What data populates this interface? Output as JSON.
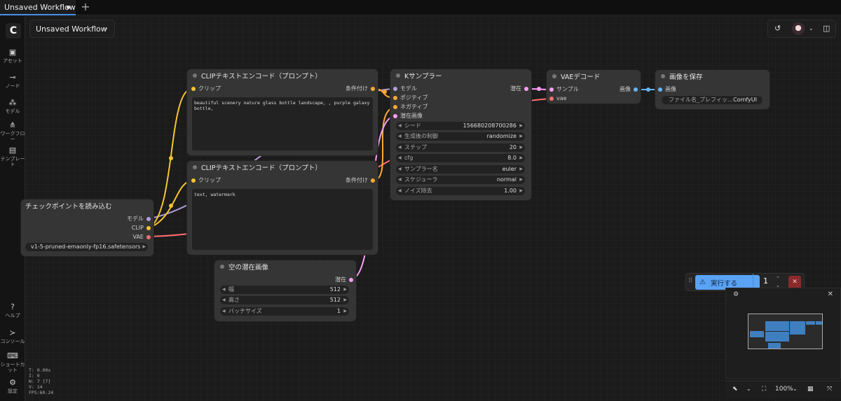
{
  "tab": {
    "title": "Unsaved Workflow",
    "new_tab": "+"
  },
  "workflow_title": "Unsaved Workflow",
  "sidebar": {
    "logo": "C",
    "items": [
      {
        "label": "アセット",
        "icon": "image-icon",
        "glyph": "▣"
      },
      {
        "label": "ノード",
        "icon": "node-icon",
        "glyph": "⊸"
      },
      {
        "label": "モデル",
        "icon": "model-icon",
        "glyph": "⁂"
      },
      {
        "label": "ワークフロー",
        "icon": "workflow-icon",
        "glyph": "⋔"
      },
      {
        "label": "テンプレート",
        "icon": "template-icon",
        "glyph": "▤"
      },
      {
        "label": "ヘルプ",
        "icon": "help-icon",
        "glyph": "?"
      },
      {
        "label": "コンソール",
        "icon": "console-icon",
        "glyph": "≻"
      },
      {
        "label": "ショートカット",
        "icon": "keyboard-icon",
        "glyph": "⌨"
      },
      {
        "label": "設定",
        "icon": "settings-icon",
        "glyph": "⚙"
      }
    ]
  },
  "nodes": {
    "clip1": {
      "title": "CLIPテキストエンコード（プロンプト）",
      "in_clip": "クリップ",
      "out_cond": "条件付け",
      "text": "beautiful scenery nature glass bottle landscape, , purple galaxy bottle,"
    },
    "clip2": {
      "title": "CLIPテキストエンコード（プロンプト）",
      "in_clip": "クリップ",
      "out_cond": "条件付け",
      "text": "text, watermark"
    },
    "checkpoint": {
      "title": "チェックポイントを読み込む",
      "out_model": "モデル",
      "out_clip": "CLIP",
      "out_vae": "VAE",
      "ckpt": "v1-5-pruned-emaonly-fp16.safetensors"
    },
    "ksampler": {
      "title": "Kサンプラー",
      "in_model": "モデル",
      "in_pos": "ポジティブ",
      "in_neg": "ネガティブ",
      "in_latent": "潜在画像",
      "out_latent": "潜在",
      "widgets": [
        {
          "label": "シード",
          "value": "156680208700286"
        },
        {
          "label": "生成後の制御",
          "value": "randomize"
        },
        {
          "label": "ステップ",
          "value": "20"
        },
        {
          "label": "cfg",
          "value": "8.0"
        },
        {
          "label": "サンプラー名",
          "value": "euler"
        },
        {
          "label": "スケジューラ",
          "value": "normal"
        },
        {
          "label": "ノイズ除去",
          "value": "1.00"
        }
      ]
    },
    "vae": {
      "title": "VAEデコード",
      "in_samples": "サンプル",
      "in_vae": "vae",
      "out_image": "画像"
    },
    "save": {
      "title": "画像を保存",
      "in_image": "画像",
      "prefix_label": "ファイル名_プレフィッ...",
      "prefix_value": "ComfyUI"
    },
    "latent": {
      "title": "空の潜在画像",
      "out_latent": "潜在",
      "widgets": [
        {
          "label": "幅",
          "value": "512"
        },
        {
          "label": "高さ",
          "value": "512"
        },
        {
          "label": "バッチサイズ",
          "value": "1"
        }
      ]
    }
  },
  "runbar": {
    "label": "実行する",
    "count": "1",
    "cancel": "✕"
  },
  "bottom": {
    "zoom": "100%"
  },
  "stats": [
    "T: 0.00s",
    "I: 0",
    "N: 7 [7]",
    "V: 14",
    "FPS:60.24"
  ],
  "colors": {
    "clip_wire": "#f4c430",
    "model_wire": "#b39ddb",
    "vae_wire": "#ff6e6e",
    "cond_wire": "#ffa931",
    "latent_wire": "#ff9cf9",
    "image_wire": "#64b5f6",
    "accent": "#5aa3f4"
  }
}
